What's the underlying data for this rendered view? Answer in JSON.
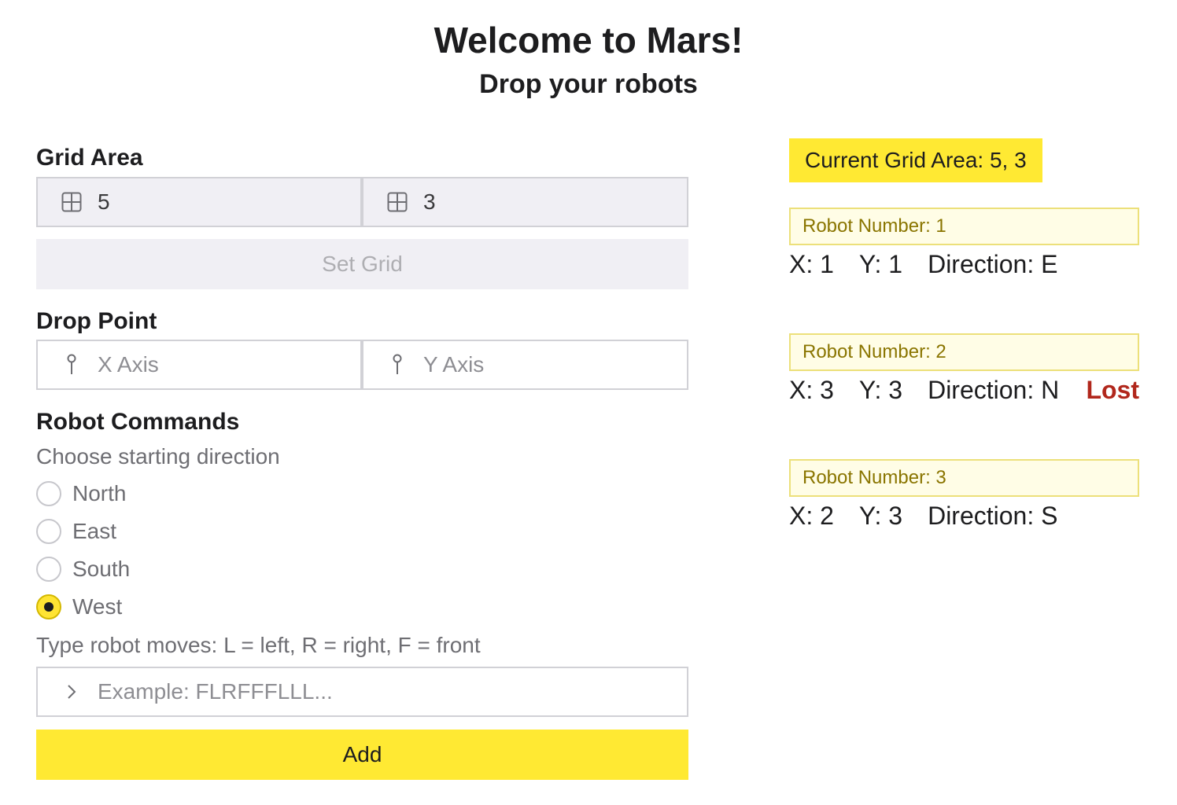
{
  "header": {
    "title": "Welcome to Mars!",
    "subtitle": "Drop your robots"
  },
  "grid_area": {
    "label": "Grid Area",
    "x_value": "5",
    "y_value": "3",
    "set_button": "Set Grid"
  },
  "drop_point": {
    "label": "Drop Point",
    "x_placeholder": "X Axis",
    "y_placeholder": "Y Axis"
  },
  "commands": {
    "label": "Robot Commands",
    "direction_hint": "Choose starting direction",
    "directions": [
      {
        "label": "North",
        "checked": false
      },
      {
        "label": "East",
        "checked": false
      },
      {
        "label": "South",
        "checked": false
      },
      {
        "label": "West",
        "checked": true
      }
    ],
    "moves_hint": "Type robot moves: L = left, R = right, F = front",
    "moves_placeholder": "Example: FLRFFFLLL...",
    "add_button": "Add"
  },
  "status": {
    "current_grid": "Current Grid Area: 5, 3",
    "robots": [
      {
        "title": "Robot Number: 1",
        "x": "X: 1",
        "y": "Y: 1",
        "direction": "Direction: E",
        "lost": ""
      },
      {
        "title": "Robot Number: 2",
        "x": "X: 3",
        "y": "Y: 3",
        "direction": "Direction: N",
        "lost": "Lost"
      },
      {
        "title": "Robot Number: 3",
        "x": "X: 2",
        "y": "Y: 3",
        "direction": "Direction: S",
        "lost": ""
      }
    ]
  },
  "icons": {
    "grid_field": "grid-icon",
    "drop_field": "pin-icon",
    "moves_field": "chevron-right-icon"
  },
  "colors": {
    "accent_yellow": "#ffe933",
    "lost_red": "#b1271c"
  }
}
